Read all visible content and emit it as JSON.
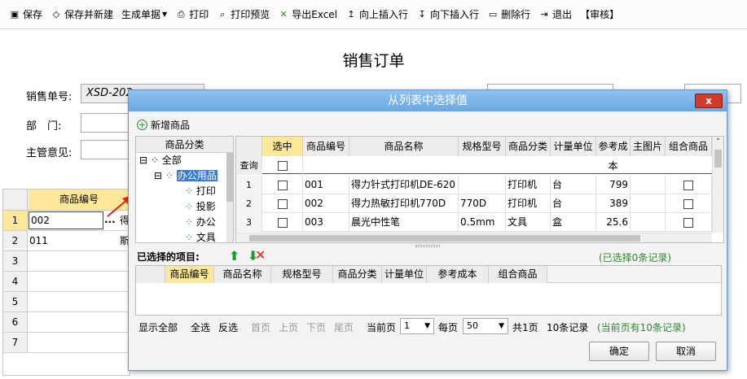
{
  "toolbar": {
    "items": [
      {
        "label": "保存",
        "icon": "save-icon"
      },
      {
        "label": "保存并新建",
        "icon": "save-new-icon"
      },
      {
        "label": "生成单据",
        "icon": "dropdown-arrow-icon"
      },
      {
        "label": "打印",
        "icon": "print-icon"
      },
      {
        "label": "打印预览",
        "icon": "print-preview-icon"
      },
      {
        "label": "导出Excel",
        "icon": "excel-icon"
      },
      {
        "label": "向上插入行",
        "icon": "insert-up-icon"
      },
      {
        "label": "向下插入行",
        "icon": "insert-down-icon"
      },
      {
        "label": "删除行",
        "icon": "delete-row-icon"
      },
      {
        "label": "退出",
        "icon": "exit-icon"
      },
      {
        "label": "【审核】",
        "icon": ""
      }
    ]
  },
  "form": {
    "title": "销售订单",
    "order_no_label": "销售单号:",
    "order_no_value": "XSD-202",
    "dept_label": "部　门:",
    "manager_label": "主管意见:"
  },
  "grid": {
    "header": "商品编号",
    "rows": [
      {
        "num": "1",
        "value": "002",
        "extra": "得"
      },
      {
        "num": "2",
        "value": "011",
        "extra": "斯"
      },
      {
        "num": "3",
        "value": "",
        "extra": ""
      },
      {
        "num": "4",
        "value": "",
        "extra": ""
      },
      {
        "num": "5",
        "value": "",
        "extra": ""
      },
      {
        "num": "6",
        "value": "",
        "extra": ""
      },
      {
        "num": "7",
        "value": "",
        "extra": ""
      }
    ],
    "ellipsis": "..."
  },
  "dialog": {
    "title": "从列表中选择值",
    "close": "x",
    "add_product": "新增商品",
    "tree": {
      "header": "商品分类",
      "items": [
        "全部",
        "办公用品",
        "打印",
        "投影",
        "办公",
        "文具"
      ]
    },
    "list": {
      "columns": [
        "选中",
        "商品编号",
        "商品名称",
        "规格型号",
        "商品分类",
        "计量单位",
        "参考成本",
        "主图片",
        "组合商品"
      ],
      "query_label": "查询",
      "rows": [
        {
          "num": "1",
          "code": "001",
          "name": "得力针式打印机DE-620",
          "spec": "",
          "cat": "打印机",
          "unit": "台",
          "cost": "799"
        },
        {
          "num": "2",
          "code": "002",
          "name": "得力热敏打印机770D",
          "spec": "770D",
          "cat": "打印机",
          "unit": "台",
          "cost": "389"
        },
        {
          "num": "3",
          "code": "003",
          "name": "晨光中性笔",
          "spec": "0.5mm",
          "cat": "文具",
          "unit": "盒",
          "cost": "25.6"
        }
      ]
    },
    "selected": {
      "label": "已选择的项目:",
      "count_text": "(已选择0条记录)",
      "columns": [
        "商品编号",
        "商品名称",
        "规格型号",
        "商品分类",
        "计量单位",
        "参考成本",
        "组合商品"
      ]
    },
    "pager": {
      "show_all": "显示全部",
      "select_all": "全选",
      "invert": "反选",
      "first": "首页",
      "prev": "上页",
      "next": "下页",
      "last": "尾页",
      "current_label": "当前页",
      "current_value": "1",
      "per_page_label": "每页",
      "per_page_value": "50",
      "total_pages": "共1页",
      "total_records": "10条记录",
      "page_records": "(当前页有10条记录)"
    },
    "ok": "确定",
    "cancel": "取消"
  },
  "colors": {
    "accent": "#6aa8e2",
    "highlight": "#fde89a",
    "green": "#2a8a2a",
    "close_red": "#d03b2c"
  }
}
